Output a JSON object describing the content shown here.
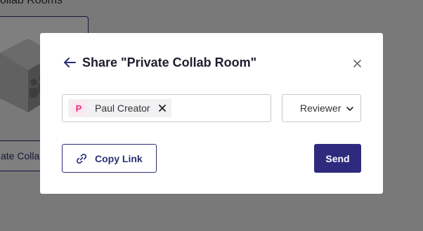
{
  "background": {
    "heading": "ollab Rooms",
    "room_chip_label": "ate Collab"
  },
  "modal": {
    "title": "Share \"Private Collab Room\"",
    "people": [
      {
        "initial": "P",
        "name": "Paul Creator"
      }
    ],
    "role": {
      "selected": "Reviewer"
    },
    "copy_link_label": "Copy Link",
    "send_label": "Send"
  },
  "colors": {
    "primary": "#2e2a7e",
    "avatar_bg": "#fde7ef",
    "avatar_text": "#e4317b"
  },
  "icons": {
    "back": "arrow-left-icon",
    "close": "close-icon",
    "remove_chip": "close-icon",
    "dropdown": "chevron-down-icon",
    "copy_link": "link-icon"
  }
}
